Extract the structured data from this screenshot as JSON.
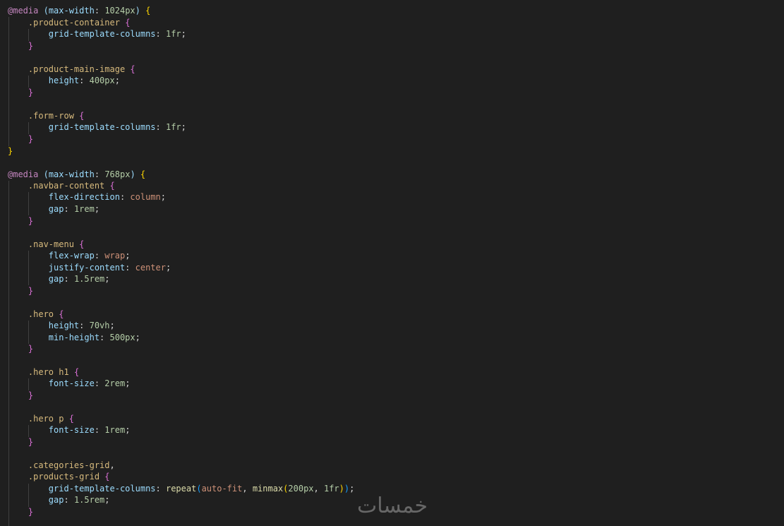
{
  "colors": {
    "background": "#1f1f1f",
    "at_rule": "#c586c0",
    "selector": "#d7ba7d",
    "property": "#9cdcfe",
    "number": "#b5cea8",
    "value": "#ce9178",
    "function": "#dcdcaa",
    "bracket_level1": "#ffd700",
    "bracket_level2": "#da70d6",
    "bracket_level3": "#179fff"
  },
  "watermark": "خمسات",
  "code": {
    "media1": {
      "at": "@media",
      "feature": "max-width",
      "value": "1024px"
    },
    "media2": {
      "at": "@media",
      "feature": "max-width",
      "value": "768px"
    },
    "sel_product_container": ".product-container",
    "sel_product_main_image": ".product-main-image",
    "sel_form_row": ".form-row",
    "sel_navbar_content": ".navbar-content",
    "sel_nav_menu": ".nav-menu",
    "sel_hero": ".hero",
    "sel_hero_h1": ".hero h1",
    "sel_hero_p": ".hero p",
    "sel_categories_grid": ".categories-grid",
    "sel_products_grid": ".products-grid",
    "p_grid_template_columns": "grid-template-columns",
    "p_height": "height",
    "p_flex_direction": "flex-direction",
    "p_gap": "gap",
    "p_flex_wrap": "flex-wrap",
    "p_justify_content": "justify-content",
    "p_min_height": "min-height",
    "p_font_size": "font-size",
    "v_1fr": "1fr",
    "v_400px": "400px",
    "v_column": "column",
    "v_1rem": "1rem",
    "v_wrap": "wrap",
    "v_center": "center",
    "v_1_5rem": "1.5rem",
    "v_70vh": "70vh",
    "v_500px": "500px",
    "v_2rem": "2rem",
    "fn_repeat": "repeat",
    "v_auto_fit": "auto-fit",
    "fn_minmax": "minmax",
    "v_200px": "200px"
  }
}
